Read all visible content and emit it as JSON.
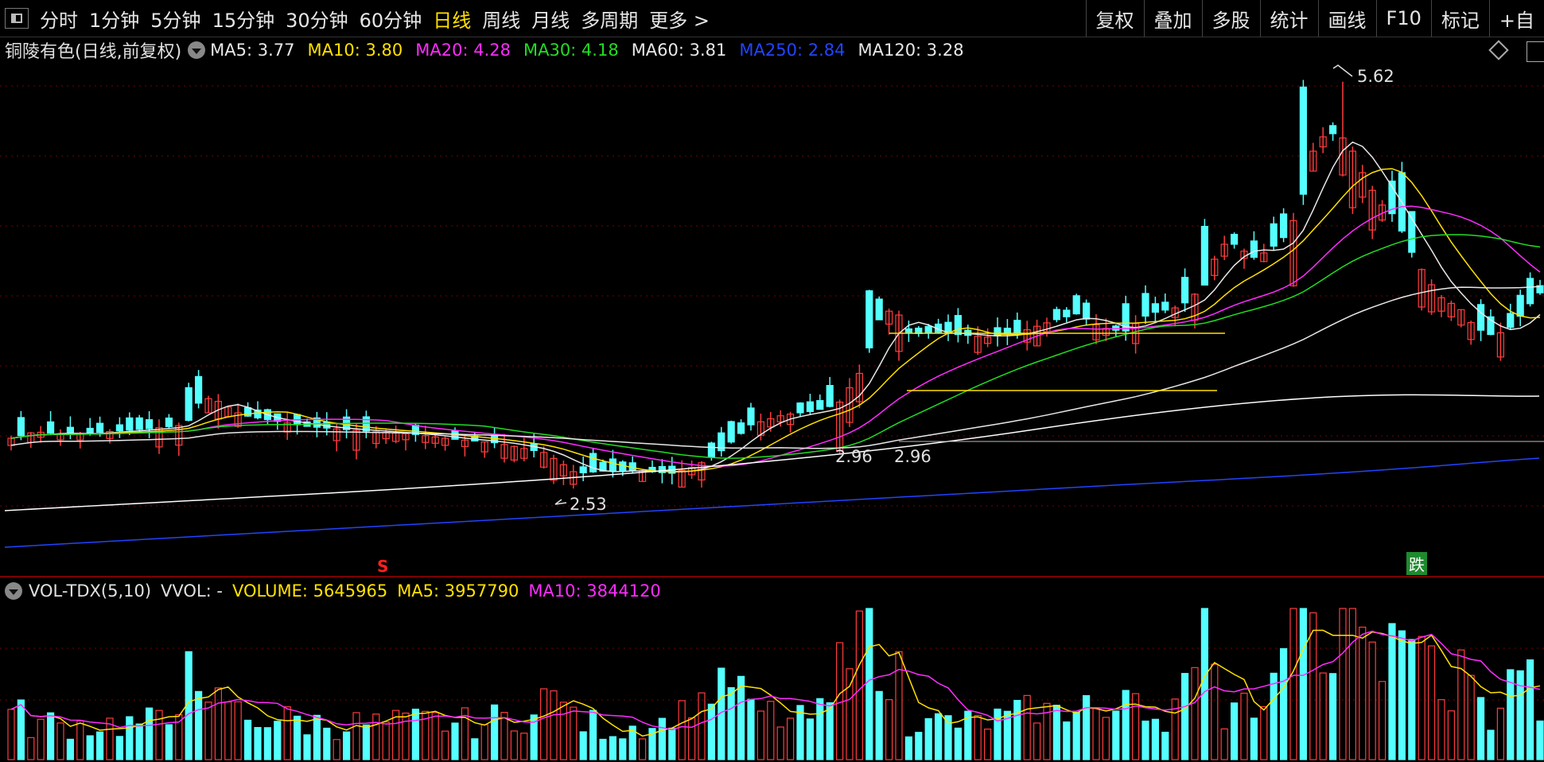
{
  "toolbar": {
    "periods": [
      {
        "label": "分时",
        "active": false
      },
      {
        "label": "1分钟",
        "active": false
      },
      {
        "label": "5分钟",
        "active": false
      },
      {
        "label": "15分钟",
        "active": false
      },
      {
        "label": "30分钟",
        "active": false
      },
      {
        "label": "60分钟",
        "active": false
      },
      {
        "label": "日线",
        "active": true
      },
      {
        "label": "周线",
        "active": false
      },
      {
        "label": "月线",
        "active": false
      },
      {
        "label": "多周期",
        "active": false
      },
      {
        "label": "更多 >",
        "active": false
      }
    ],
    "tools": [
      "复权",
      "叠加",
      "多股",
      "统计",
      "画线",
      "F10",
      "标记",
      "+自"
    ]
  },
  "legend": {
    "stock_name": "铜陵有色(日线,前复权)",
    "mas": [
      {
        "label": "MA5: 3.77",
        "color": "#e8e8e8"
      },
      {
        "label": "MA10: 3.80",
        "color": "#ffe100"
      },
      {
        "label": "MA20: 4.28",
        "color": "#ff2cff"
      },
      {
        "label": "MA30: 4.18",
        "color": "#22dd22"
      },
      {
        "label": "MA60: 3.81",
        "color": "#e8e8e8"
      },
      {
        "label": "MA250: 2.84",
        "color": "#2244ff"
      },
      {
        "label": "MA120: 3.28",
        "color": "#e8e8e8"
      }
    ]
  },
  "annotations": {
    "peak": "5.62",
    "low": "2.53",
    "range_left": "2.96",
    "range_right": "2.96",
    "sell_mark": "S",
    "fall_badge": "跌"
  },
  "volume_legend": {
    "name": "VOL-TDX(5,10)",
    "vvol": "VVOL: -",
    "volume": "VOLUME: 5645965",
    "ma5": "MA5: 3957790",
    "ma10": "MA10: 3844120"
  },
  "colors": {
    "up": "#ff3c3c",
    "down": "#54ffff",
    "ma5": "#e8e8e8",
    "ma10": "#ffe100",
    "ma20": "#ff2cff",
    "ma30": "#22dd22",
    "ma60": "#e8e8e8",
    "ma120": "#ffffff",
    "ma250": "#2244ff",
    "grid": "#7a0000"
  },
  "chart_data": {
    "type": "candlestick",
    "price_levels": {
      "peak": 5.62,
      "low": 2.53,
      "range": 2.96
    }
  }
}
